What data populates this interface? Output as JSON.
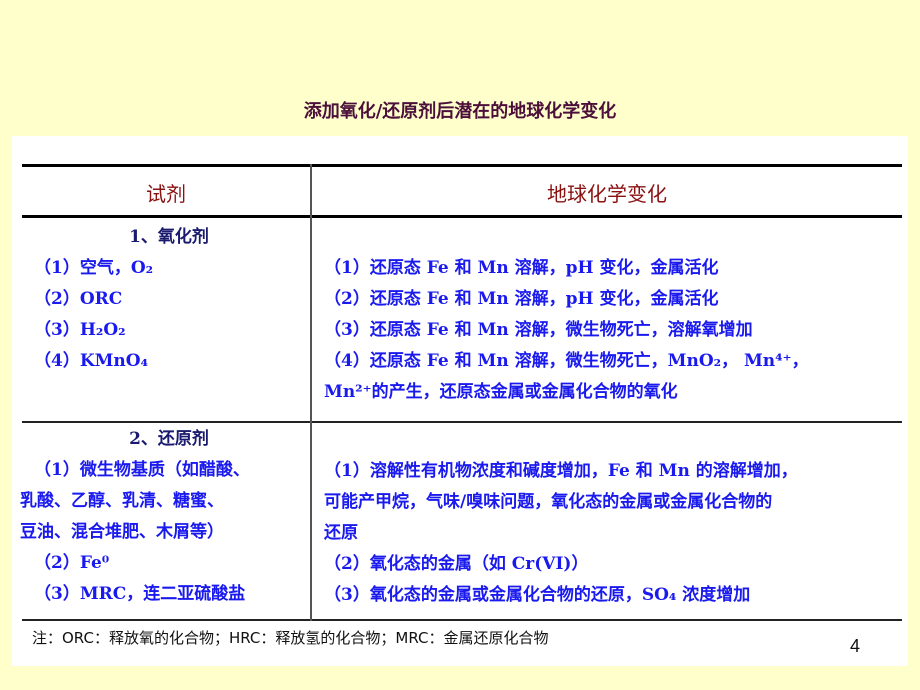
{
  "title": "添加氧化/还原剂后潜在的地球化学变化",
  "table": {
    "headers": {
      "reagent": "试剂",
      "change": "地球化学变化"
    },
    "sections": [
      {
        "heading": "1、氧化剂",
        "reagents": [
          "（1）空气，O₂",
          "（2）ORC",
          "（3）H₂O₂",
          "（4）KMnO₄"
        ],
        "changes": [
          "（1）还原态 Fe 和 Mn 溶解，pH 变化，金属活化",
          "（2）还原态 Fe 和 Mn 溶解，pH 变化，金属活化",
          "（3）还原态 Fe 和 Mn 溶解，微生物死亡，溶解氧增加",
          "（4）还原态 Fe 和 Mn 溶解，微生物死亡，MnO₂，  Mn⁴⁺，",
          "Mn²⁺的产生，还原态金属或金属化合物的氧化"
        ]
      },
      {
        "heading": "2、还原剂",
        "reagents": [
          "（1）微生物基质（如醋酸、",
          "乳酸、乙醇、乳清、糖蜜、",
          "豆油、混合堆肥、木屑等）",
          "（2）Fe⁰",
          "（3）MRC，连二亚硫酸盐"
        ],
        "changes": [
          "（1）溶解性有机物浓度和碱度增加，Fe 和 Mn 的溶解增加，",
          "可能产甲烷，气味/嗅味问题，氧化态的金属或金属化合物的",
          "还原",
          "（2）氧化态的金属（如 Cr(VI)）",
          "（3）氧化态的金属或金属化合物的还原，SO₄ 浓度增加"
        ]
      }
    ]
  },
  "note": "注：ORC：释放氧的化合物；HRC：释放氢的化合物；MRC：金属还原化合物",
  "page_number": "4",
  "colors": {
    "background": "#ffffcc",
    "panel": "#ffffff",
    "header_text": "#8b1010",
    "body_text": "#1a1aee",
    "title_text": "#4b0f3a"
  }
}
